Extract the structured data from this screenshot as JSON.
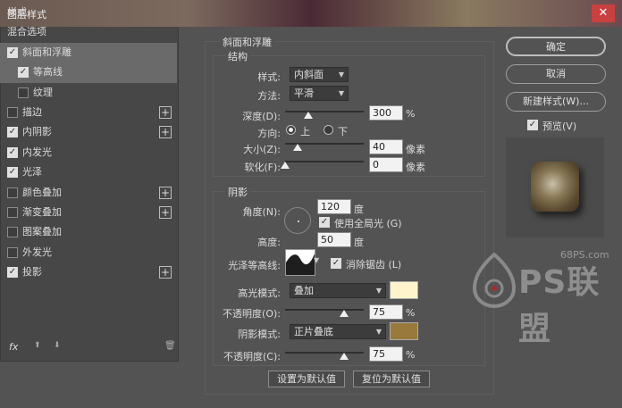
{
  "window": {
    "title": "图层样式",
    "close": "✕"
  },
  "styles_list": {
    "items": [
      {
        "label": "样式",
        "checkbox": false,
        "checked": false,
        "plus": false,
        "indent": 0
      },
      {
        "label": "混合选项",
        "checkbox": false,
        "checked": false,
        "plus": false,
        "indent": 0
      },
      {
        "label": "斜面和浮雕",
        "checkbox": true,
        "checked": true,
        "plus": false,
        "indent": 0,
        "active": true
      },
      {
        "label": "等高线",
        "checkbox": true,
        "checked": true,
        "plus": false,
        "indent": 1,
        "active": true
      },
      {
        "label": "纹理",
        "checkbox": true,
        "checked": false,
        "plus": false,
        "indent": 1
      },
      {
        "label": "描边",
        "checkbox": true,
        "checked": false,
        "plus": true,
        "indent": 0
      },
      {
        "label": "内阴影",
        "checkbox": true,
        "checked": true,
        "plus": true,
        "indent": 0
      },
      {
        "label": "内发光",
        "checkbox": true,
        "checked": true,
        "plus": false,
        "indent": 0
      },
      {
        "label": "光泽",
        "checkbox": true,
        "checked": true,
        "plus": false,
        "indent": 0
      },
      {
        "label": "颜色叠加",
        "checkbox": true,
        "checked": false,
        "plus": true,
        "indent": 0
      },
      {
        "label": "渐变叠加",
        "checkbox": true,
        "checked": false,
        "plus": true,
        "indent": 0
      },
      {
        "label": "图案叠加",
        "checkbox": true,
        "checked": false,
        "plus": false,
        "indent": 0
      },
      {
        "label": "外发光",
        "checkbox": true,
        "checked": false,
        "plus": false,
        "indent": 0
      },
      {
        "label": "投影",
        "checkbox": true,
        "checked": true,
        "plus": true,
        "indent": 0
      }
    ],
    "footer": {
      "fx": "fx",
      "up": "⬆",
      "down": "⬇",
      "trash": "🗑"
    }
  },
  "bevel": {
    "title": "斜面和浮雕",
    "structure": {
      "title": "结构",
      "style_label": "样式:",
      "style_value": "内斜面",
      "technique_label": "方法:",
      "technique_value": "平滑",
      "depth_label": "深度(D):",
      "depth_value": "300",
      "depth_unit": "%",
      "depth_level": 0.3,
      "direction_label": "方向:",
      "direction_up": "上",
      "direction_down": "下",
      "size_label": "大小(Z):",
      "size_value": "40",
      "size_unit": "像素",
      "size_level": 0.16,
      "soften_label": "软化(F):",
      "soften_value": "0",
      "soften_unit": "像素",
      "soften_level": 0.0
    },
    "shading": {
      "title": "阴影",
      "angle_label": "角度(N):",
      "angle_value": "120",
      "angle_unit": "度",
      "global_light_label": "使用全局光 (G)",
      "altitude_label": "高度:",
      "altitude_value": "50",
      "altitude_unit": "度",
      "gloss_contour_label": "光泽等高线:",
      "anti_alias_label": "消除锯齿 (L)",
      "highlight_mode_label": "高光模式:",
      "highlight_mode_value": "叠加",
      "highlight_color": "#fff4cc",
      "highlight_opacity_label": "不透明度(O):",
      "highlight_opacity_value": "75",
      "highlight_opacity_unit": "%",
      "highlight_opacity_level": 0.75,
      "shadow_mode_label": "阴影模式:",
      "shadow_mode_value": "正片叠底",
      "shadow_color": "#9a7a3c",
      "shadow_opacity_label": "不透明度(C):",
      "shadow_opacity_value": "75",
      "shadow_opacity_unit": "%",
      "shadow_opacity_level": 0.75
    },
    "make_default": "设置为默认值",
    "reset_default": "复位为默认值"
  },
  "buttons": {
    "ok": "确定",
    "cancel": "取消",
    "new_style": "新建样式(W)...",
    "preview": "预览(V)"
  },
  "watermark": {
    "site": "68PS.com",
    "brand": "PS联盟"
  }
}
